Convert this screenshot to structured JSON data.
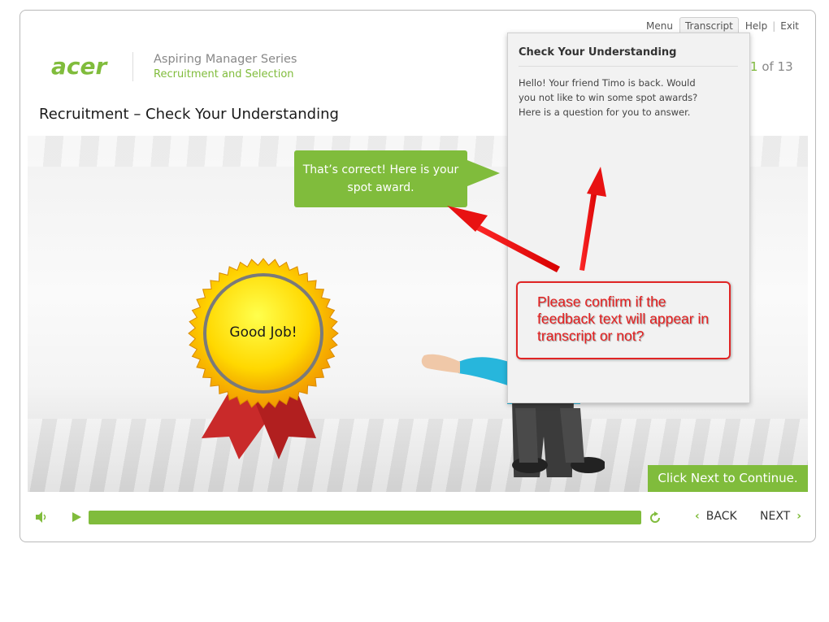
{
  "nav": {
    "menu": "Menu",
    "transcript": "Transcript",
    "help": "Help",
    "exit": "Exit",
    "separator": "|"
  },
  "header": {
    "logo_text": "acer",
    "series_title": "Aspiring Manager Series",
    "course_title": "Recruitment and Selection",
    "page_current": "1",
    "page_of": " of 13"
  },
  "page_title": "Recruitment – Check Your Understanding",
  "stage": {
    "speech_bubble": "That’s correct! Here is your spot award.",
    "badge_text": "Good Job!",
    "next_hint": "Click Next to Continue."
  },
  "transcript_panel": {
    "title": "Check Your Understanding",
    "body": "Hello! Your friend Timo is back. Would you not like to win some spot awards? Here is a question for you to answer."
  },
  "annotation": {
    "text": "Please confirm if the feedback text will appear in transcript or not?"
  },
  "player": {
    "progress": 1.0,
    "back_label": "BACK",
    "next_label": "NEXT"
  },
  "colors": {
    "accent": "#80bc3c",
    "annotation": "#e51f1f"
  }
}
